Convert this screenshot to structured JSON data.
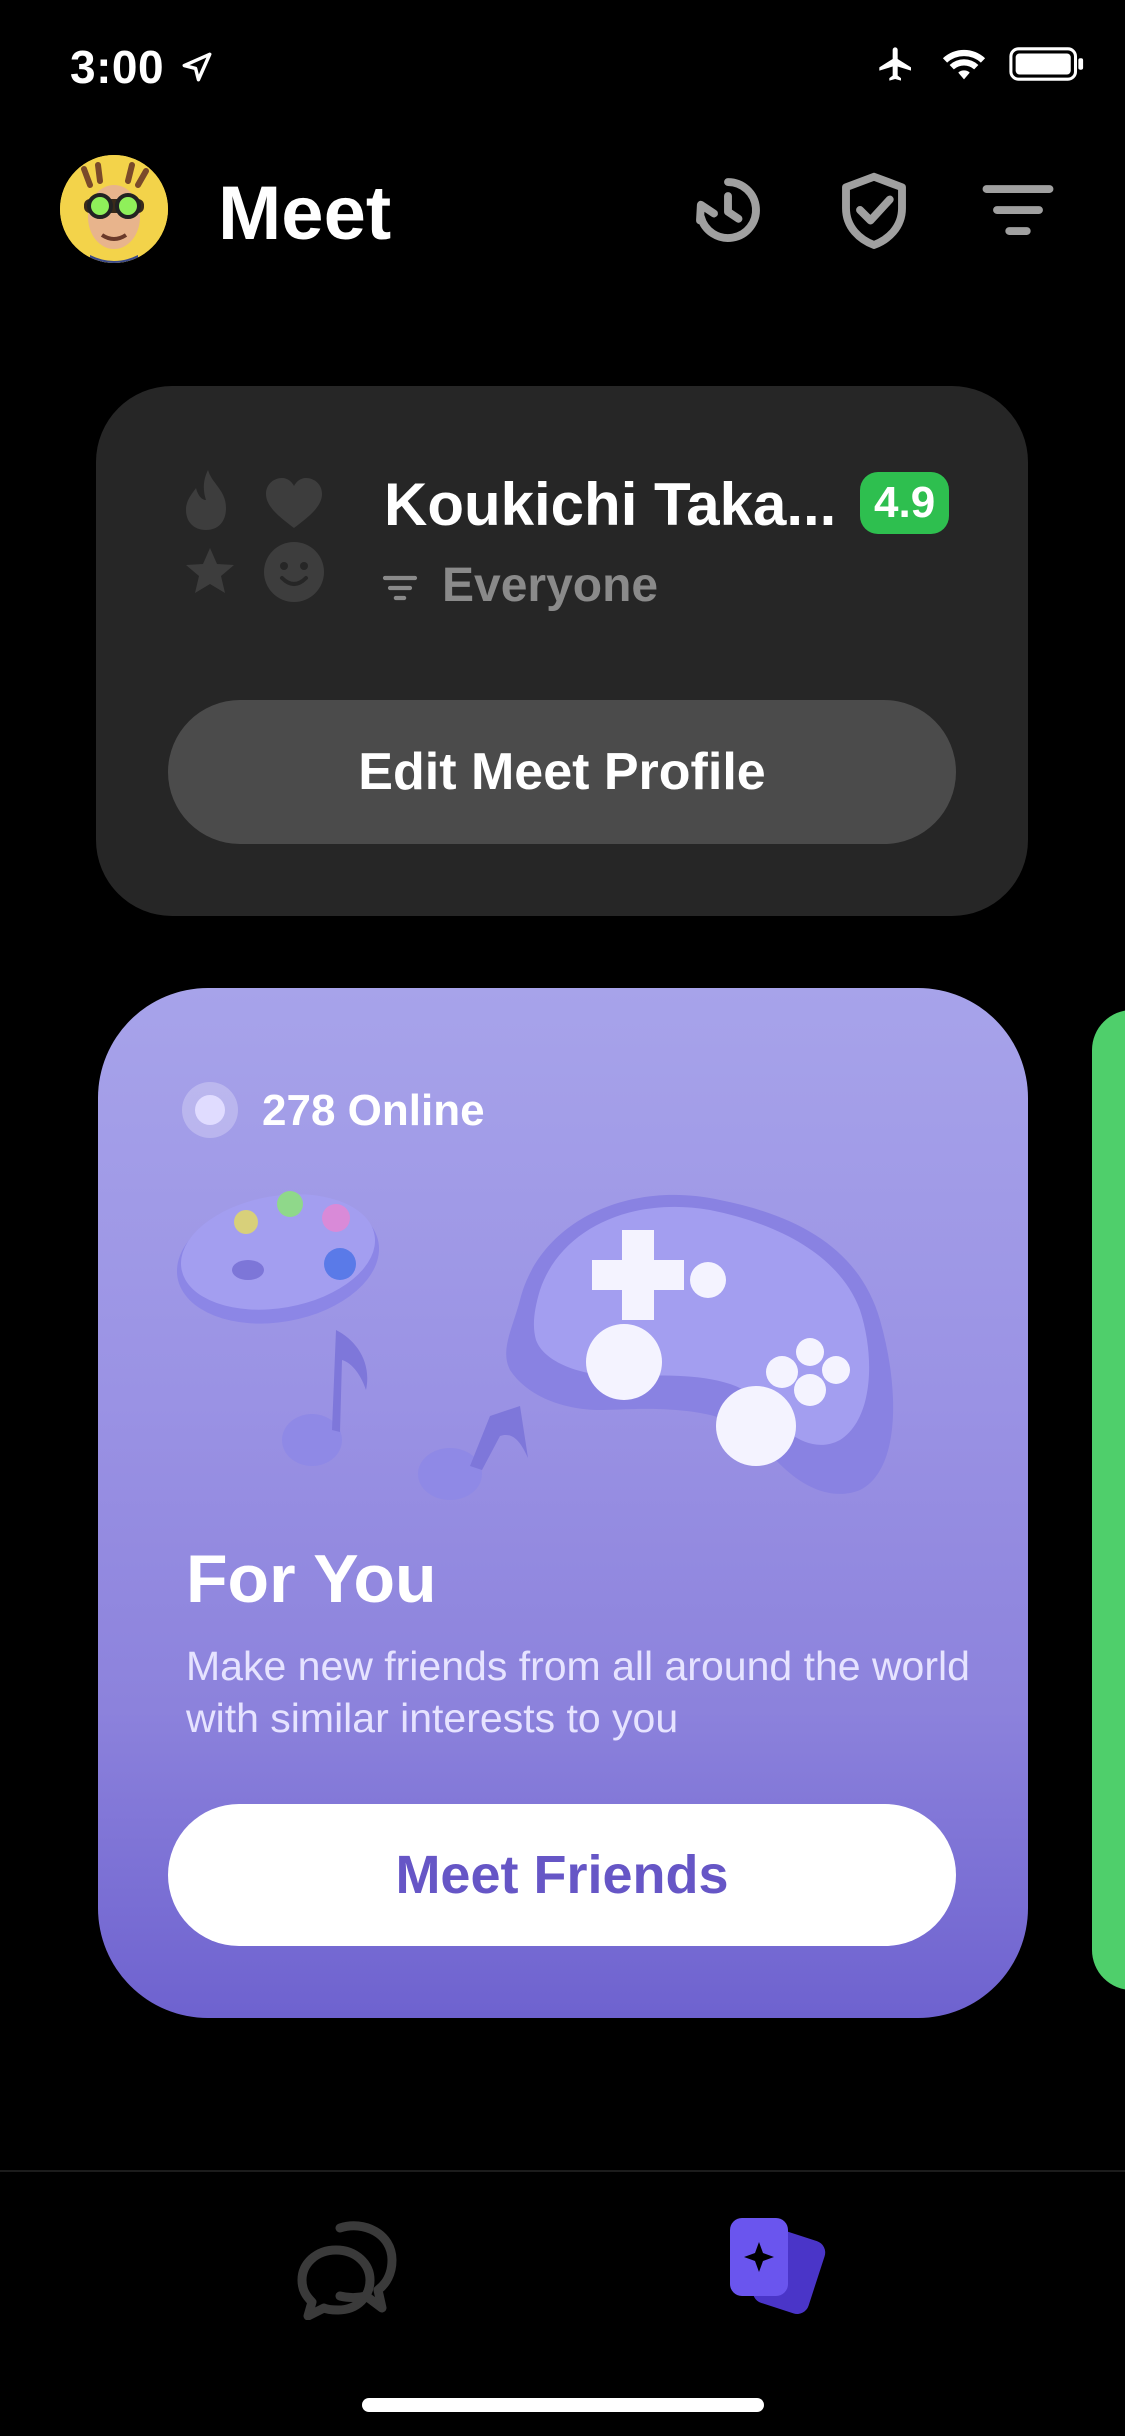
{
  "status_bar": {
    "time": "3:00"
  },
  "header": {
    "title": "Meet"
  },
  "profile": {
    "name": "Koukichi Taka...",
    "rating": "4.9",
    "filter": "Everyone",
    "edit_label": "Edit Meet Profile"
  },
  "for_you": {
    "online": "278 Online",
    "title": "For You",
    "description": "Make new friends from all around the world with similar interests to you",
    "button": "Meet Friends"
  },
  "colors": {
    "accent_purple": "#6656c6",
    "rating_green": "#2ebf4f",
    "card_gradient_top": "#a7a3ea",
    "card_gradient_bottom": "#6e62cf",
    "nav_active": "#5b45e0"
  },
  "icons": {
    "header": [
      "history-icon",
      "shield-check-icon",
      "filter-icon"
    ],
    "stats": [
      "flame-icon",
      "heart-icon",
      "star-icon",
      "smiley-icon"
    ],
    "nav": [
      "chat-icon",
      "meet-cards-icon"
    ]
  }
}
